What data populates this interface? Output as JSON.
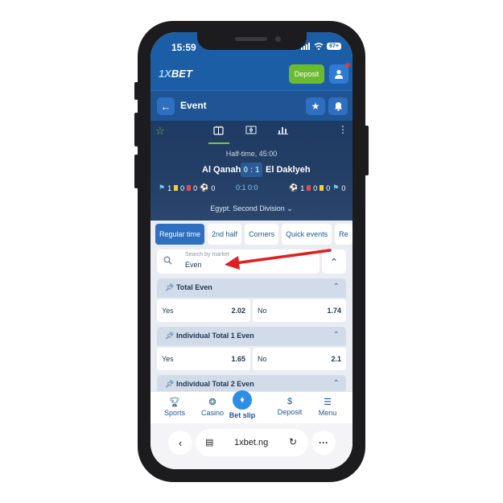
{
  "status": {
    "time": "15:59",
    "battery": "67+"
  },
  "header": {
    "logo_prefix": "1X",
    "logo_suffix": "BET",
    "deposit_label": "Deposit"
  },
  "event_bar": {
    "title": "Event",
    "back_icon": "arrow-left-icon",
    "star_icon": "star-icon",
    "bell_icon": "bell-icon"
  },
  "scoreboard": {
    "status": "Half-time, 45:00",
    "team1": "Al Qanah",
    "team2": "El Daklyeh",
    "score": "0 : 1",
    "team1_stats": [
      "1",
      "0",
      "0",
      "0"
    ],
    "team2_stats": [
      "1",
      "0",
      "0",
      "0"
    ],
    "half_scores": "0:1   0:0",
    "league": "Egypt. Second Division"
  },
  "tabs": [
    "Regular time",
    "2nd half",
    "Corners",
    "Quick events",
    "Re"
  ],
  "search": {
    "placeholder": "Search by market",
    "value": "Even"
  },
  "markets": [
    {
      "title": "Total Even",
      "left_label": "Yes",
      "left_odd": "2.02",
      "right_label": "No",
      "right_odd": "1.74"
    },
    {
      "title": "Individual Total 1 Even",
      "left_label": "Yes",
      "left_odd": "1.65",
      "right_label": "No",
      "right_odd": "2.1"
    },
    {
      "title": "Individual Total 2 Even"
    }
  ],
  "bottom_nav": {
    "sports": "Sports",
    "casino": "Casino",
    "betslip": "Bet slip",
    "deposit": "Deposit",
    "menu": "Menu"
  },
  "browser": {
    "url": "1xbet.ng"
  },
  "colors": {
    "brand": "#1b5ea6",
    "accent_green": "#6cbb2f",
    "arrow": "#e02020"
  }
}
